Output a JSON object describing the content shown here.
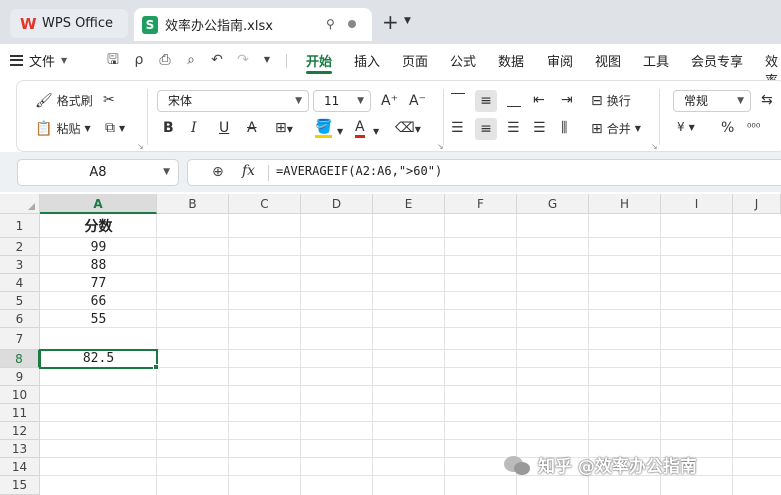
{
  "tabs": {
    "app_label": "WPS Office",
    "file_label": "效率办公指南.xlsx"
  },
  "menu": {
    "file_label": "文件",
    "items": [
      "开始",
      "插入",
      "页面",
      "公式",
      "数据",
      "审阅",
      "视图",
      "工具",
      "会员专享",
      "效率"
    ],
    "active": "开始"
  },
  "ribbon": {
    "format_painter": "格式刷",
    "paste": "粘贴",
    "font_name": "宋体",
    "font_size": "11",
    "wrap": "换行",
    "merge": "合并",
    "number_format": "常规",
    "currency": "¥",
    "percent": "%"
  },
  "formula_bar": {
    "name_box": "A8",
    "fx": "fx",
    "formula": "=AVERAGEIF(A2:A6,\">60\")"
  },
  "grid": {
    "columns": [
      "A",
      "B",
      "C",
      "D",
      "E",
      "F",
      "G",
      "H",
      "I",
      "J"
    ],
    "rows": [
      "1",
      "2",
      "3",
      "4",
      "5",
      "6",
      "7",
      "8",
      "9",
      "10",
      "11",
      "12",
      "13",
      "14",
      "15"
    ],
    "selected_column": "A",
    "selected_row": "8",
    "cells": {
      "A1": "分数",
      "A2": "99",
      "A3": "88",
      "A4": "77",
      "A5": "66",
      "A6": "55",
      "A8": "82.5"
    }
  },
  "watermark": "知乎 @效率办公指南",
  "colors": {
    "accent": "#1b7a43",
    "sheet_icon": "#1f9f5f",
    "wps_logo": "#e4352b"
  }
}
